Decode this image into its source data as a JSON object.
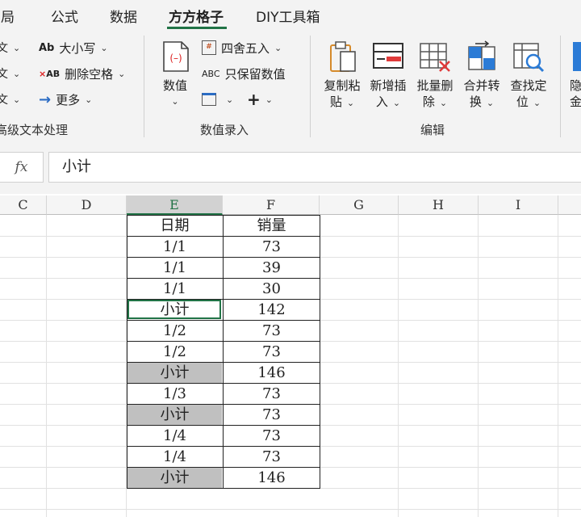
{
  "tabs": [
    {
      "label": "布局",
      "display": "布局"
    },
    {
      "label": "公式"
    },
    {
      "label": "数据"
    },
    {
      "label": "方方格子"
    },
    {
      "label": "DIY工具箱"
    }
  ],
  "ribbon": {
    "text_group": {
      "case_label": "大小写",
      "remove_space_label": "删除空格",
      "more_label": "更多",
      "group_label": "高级文本处理"
    },
    "numeric_group": {
      "value_label": "数值",
      "round_label": "四舍五入",
      "keep_numbers_label": "只保留数值",
      "group_label": "数值录入"
    },
    "edit_group": {
      "copy_paste_label": [
        "复制粘",
        "贴"
      ],
      "insert_label": [
        "新增插",
        "入"
      ],
      "batch_delete_label": [
        "批量删",
        "除"
      ],
      "merge_label": [
        "合并转",
        "换"
      ],
      "find_label": [
        "查找定",
        "位"
      ],
      "partial_label": [
        "隐",
        "金"
      ],
      "group_label": "编辑"
    }
  },
  "formula_bar": {
    "fx": "fx",
    "value": "小计"
  },
  "columns": [
    "C",
    "D",
    "E",
    "F",
    "G",
    "H",
    "I"
  ],
  "selected_column": "E",
  "table": {
    "headers": [
      "日期",
      "销量"
    ],
    "rows": [
      {
        "date": "1/1",
        "sales": "73",
        "subtotal": false
      },
      {
        "date": "1/1",
        "sales": "39",
        "subtotal": false
      },
      {
        "date": "1/1",
        "sales": "30",
        "subtotal": false
      },
      {
        "date": "小计",
        "sales": "142",
        "subtotal": true,
        "active": true
      },
      {
        "date": "1/2",
        "sales": "73",
        "subtotal": false
      },
      {
        "date": "1/2",
        "sales": "73",
        "subtotal": false
      },
      {
        "date": "小计",
        "sales": "146",
        "subtotal": true
      },
      {
        "date": "1/3",
        "sales": "73",
        "subtotal": false
      },
      {
        "date": "小计",
        "sales": "73",
        "subtotal": true
      },
      {
        "date": "1/4",
        "sales": "73",
        "subtotal": false
      },
      {
        "date": "1/4",
        "sales": "73",
        "subtotal": false
      },
      {
        "date": "小计",
        "sales": "146",
        "subtotal": true
      }
    ]
  },
  "colors": {
    "accent_green": "#217346",
    "highlight_gray": "#c0c0c0",
    "ribbon_bg": "#f3f3f3"
  }
}
